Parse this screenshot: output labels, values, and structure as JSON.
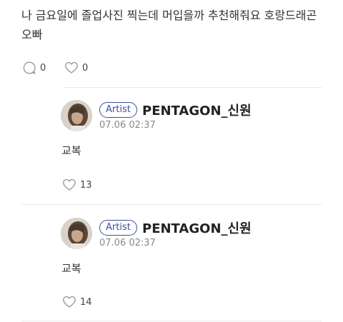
{
  "post": {
    "text": "나 금요일에 졸업사진 찍는데 머입을까 추천해줘요 호랑드래곤 오빠",
    "comment_count": "0",
    "like_count": "0"
  },
  "replies": [
    {
      "badge": "Artist",
      "author": "PENTAGON_신원",
      "timestamp": "07.06 02:37",
      "text": "교복",
      "like_count": "13"
    },
    {
      "badge": "Artist",
      "author": "PENTAGON_신원",
      "timestamp": "07.06 02:37",
      "text": "교복",
      "like_count": "14"
    }
  ],
  "icons": {
    "comment": "comment-bubble-icon",
    "like": "heart-icon"
  },
  "colors": {
    "badge": "#3d4f9a",
    "divider": "#e7e7e7",
    "timestamp": "#888888"
  }
}
